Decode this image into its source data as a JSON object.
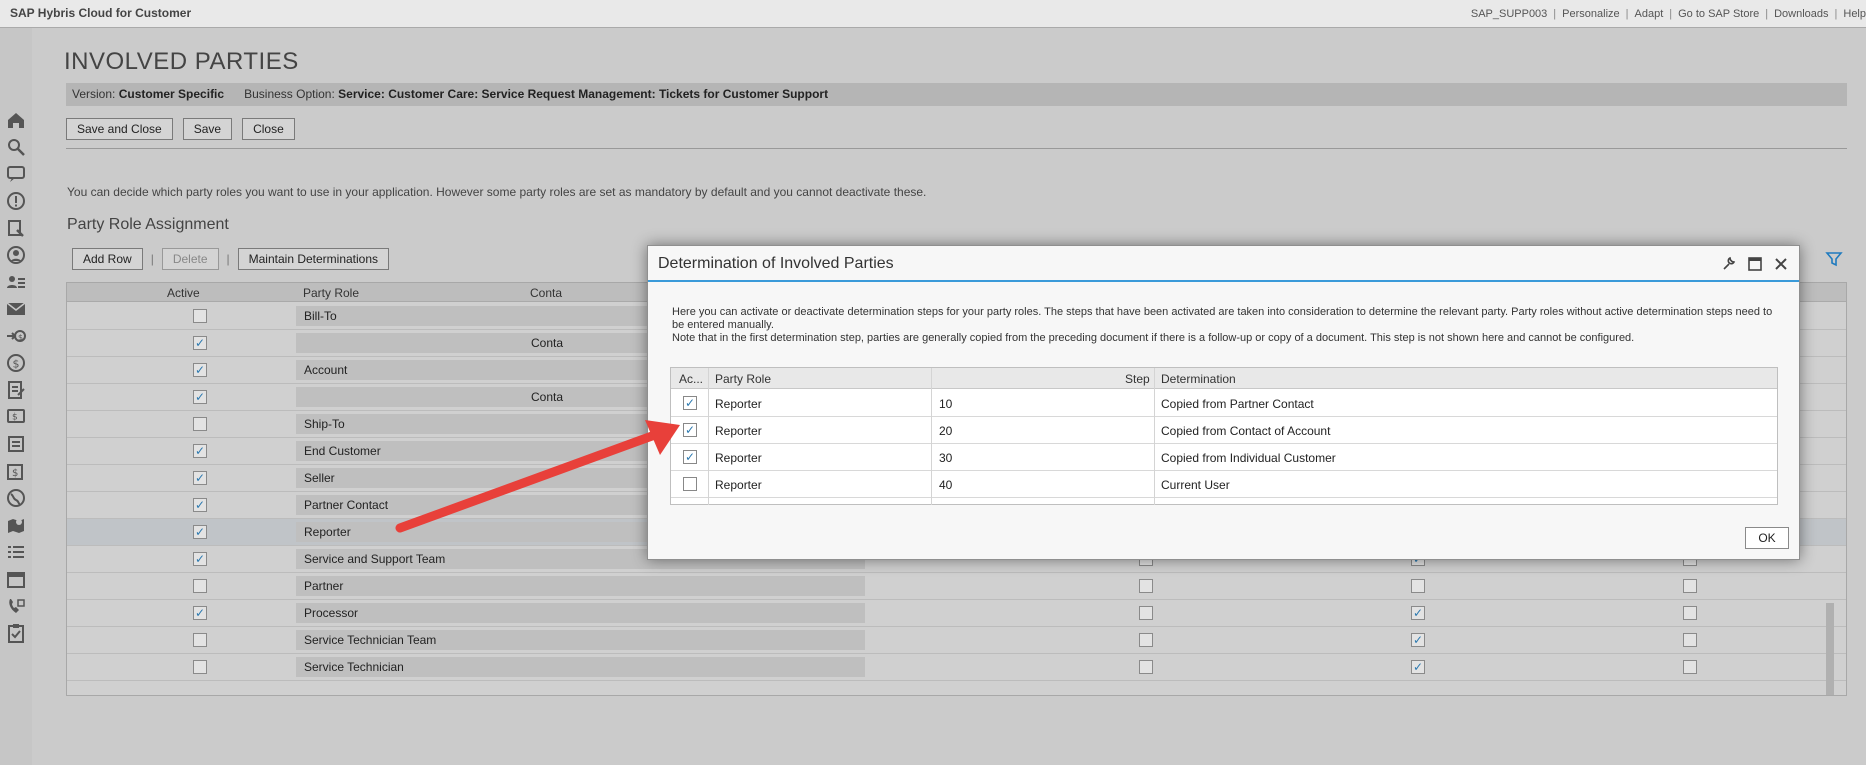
{
  "app": {
    "title": "SAP Hybris Cloud for Customer",
    "links": [
      "SAP_SUPP003",
      "Personalize",
      "Adapt",
      "Go to SAP Store",
      "Downloads",
      "Help"
    ]
  },
  "nav_icons": [
    "home-icon",
    "search-icon",
    "feed-icon",
    "alert-icon",
    "worklist-icon",
    "user-icon",
    "contacts-icon",
    "mail-icon",
    "sales-icon",
    "money-icon",
    "document-icon",
    "chat-icon",
    "ticket-icon",
    "invoice-icon",
    "globe-icon",
    "map-icon",
    "list-icon",
    "calendar-icon",
    "phone-icon",
    "clipboard-icon"
  ],
  "page": {
    "title": "INVOLVED PARTIES",
    "version_label": "Version:",
    "version_value": "Customer Specific",
    "option_label": "Business Option:",
    "option_value": "Service: Customer Care: Service Request Management: Tickets for Customer Support",
    "buttons": {
      "save_close": "Save and Close",
      "save": "Save",
      "close": "Close"
    },
    "hint": "You can decide which party roles you want to use in your application. However some party roles are set as mandatory by default and you cannot deactivate these.",
    "section": "Party Role Assignment",
    "toolbar": {
      "add_row": "Add Row",
      "delete": "Delete",
      "maintain": "Maintain Determinations"
    },
    "columns": {
      "active": "Active",
      "party_role": "Party Role",
      "contact": "Conta"
    }
  },
  "grid_rows": [
    {
      "active": false,
      "role": "Bill-To",
      "contact": "",
      "c1": false,
      "c2": false,
      "c3": false
    },
    {
      "active": true,
      "role": "",
      "contact": "Conta",
      "c1": false,
      "c2": false,
      "c3": false
    },
    {
      "active": true,
      "role": "Account",
      "contact": "",
      "c1": false,
      "c2": false,
      "c3": false
    },
    {
      "active": true,
      "role": "",
      "contact": "Conta",
      "c1": false,
      "c2": false,
      "c3": false
    },
    {
      "active": false,
      "role": "Ship-To",
      "contact": "",
      "c1": false,
      "c2": false,
      "c3": false
    },
    {
      "active": true,
      "role": "End Customer",
      "contact": "",
      "c1": false,
      "c2": false,
      "c3": false
    },
    {
      "active": true,
      "role": "Seller",
      "contact": "",
      "c1": false,
      "c2": false,
      "c3": false
    },
    {
      "active": true,
      "role": "Partner Contact",
      "contact": "",
      "c1": false,
      "c2": false,
      "c3": false
    },
    {
      "active": true,
      "role": "Reporter",
      "contact": "",
      "c1": false,
      "c2": false,
      "c3": false,
      "selected": true
    },
    {
      "active": true,
      "role": "Service and Support Team",
      "contact": "",
      "c1": false,
      "c2": true,
      "c3": false
    },
    {
      "active": false,
      "role": "Partner",
      "contact": "",
      "c1": false,
      "c2": false,
      "c3": false
    },
    {
      "active": true,
      "role": "Processor",
      "contact": "",
      "c1": false,
      "c2": true,
      "c3": false
    },
    {
      "active": false,
      "role": "Service Technician Team",
      "contact": "",
      "c1": false,
      "c2": true,
      "c3": false
    },
    {
      "active": false,
      "role": "Service Technician",
      "contact": "",
      "c1": false,
      "c2": true,
      "c3": false
    }
  ],
  "dialog": {
    "title": "Determination of Involved Parties",
    "text1": "Here you can activate or deactivate determination steps for your party roles. The steps that have been activated are taken into consideration to determine the relevant party. Party roles without active determination steps need to be entered manually.",
    "text2": "Note that in the first determination step, parties are generally copied from the preceding document if there is a follow-up or copy of a document. This step is not shown here and cannot be configured.",
    "columns": {
      "active": "Ac...",
      "party_role": "Party Role",
      "step": "Step",
      "determination": "Determination"
    },
    "rows": [
      {
        "active": true,
        "role": "Reporter",
        "step": "10",
        "determination": "Copied from Partner Contact"
      },
      {
        "active": true,
        "role": "Reporter",
        "step": "20",
        "determination": "Copied from Contact of Account"
      },
      {
        "active": true,
        "role": "Reporter",
        "step": "30",
        "determination": "Copied from Individual Customer"
      },
      {
        "active": false,
        "role": "Reporter",
        "step": "40",
        "determination": "Current User"
      }
    ],
    "ok": "OK"
  },
  "colors": {
    "accent": "#3a9ad9",
    "annotation_arrow": "#e8403a"
  }
}
